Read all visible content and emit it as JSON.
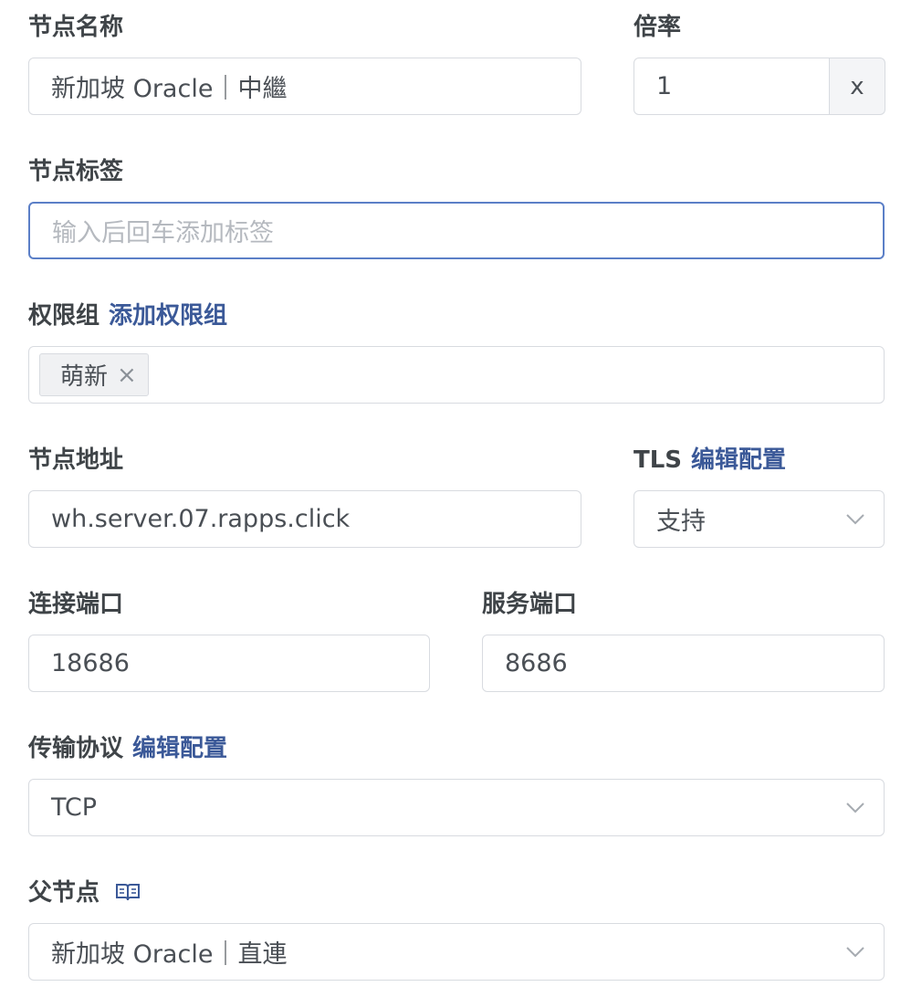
{
  "node_name": {
    "label": "节点名称",
    "value": "新加坡 Oracle｜中繼"
  },
  "rate": {
    "label": "倍率",
    "value": "1",
    "suffix": "x"
  },
  "node_tags": {
    "label": "节点标签",
    "placeholder": "输入后回车添加标签"
  },
  "permission_group": {
    "label": "权限组",
    "link": "添加权限组",
    "tags": [
      {
        "label": "萌新",
        "remove": "×"
      }
    ]
  },
  "node_address": {
    "label": "节点地址",
    "value": "wh.server.07.rapps.click"
  },
  "tls": {
    "label": "TLS",
    "link": "编辑配置",
    "value": "支持"
  },
  "connect_port": {
    "label": "连接端口",
    "value": "18686"
  },
  "service_port": {
    "label": "服务端口",
    "value": "8686"
  },
  "transport": {
    "label": "传输协议",
    "link": "编辑配置",
    "value": "TCP"
  },
  "parent_node": {
    "label": "父节点",
    "icon": "book-icon",
    "value": "新加坡 Oracle｜直連"
  },
  "colors": {
    "link": "#3b5998",
    "border": "#d8dbe0",
    "focus_border": "#5b7fc7",
    "placeholder": "#b5b9bf"
  }
}
